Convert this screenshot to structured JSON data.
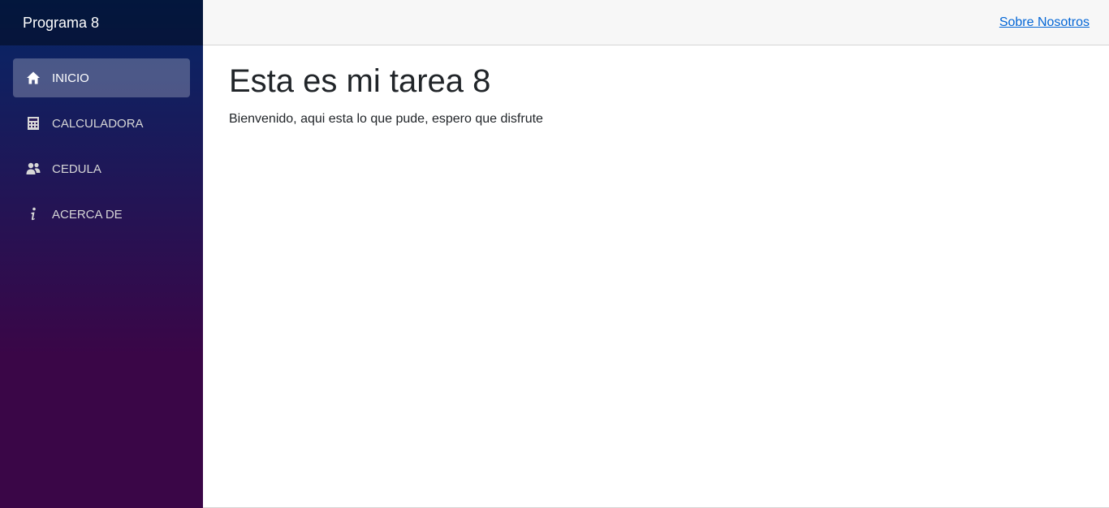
{
  "sidebar": {
    "brand": "Programa 8",
    "gradient_top": "#052767",
    "gradient_bottom": "#3a0647",
    "items": [
      {
        "label": "INICIO",
        "icon": "home-icon",
        "active": true
      },
      {
        "label": "CALCULADORA",
        "icon": "calculator-icon",
        "active": false
      },
      {
        "label": "CEDULA",
        "icon": "people-icon",
        "active": false
      },
      {
        "label": "ACERCA DE",
        "icon": "info-icon",
        "active": false
      }
    ]
  },
  "header": {
    "link_label": "Sobre Nosotros",
    "link_color": "#0366d6"
  },
  "main": {
    "title": "Esta es mi tarea 8",
    "text": "Bienvenido, aqui esta lo que pude, espero que disfrute"
  }
}
